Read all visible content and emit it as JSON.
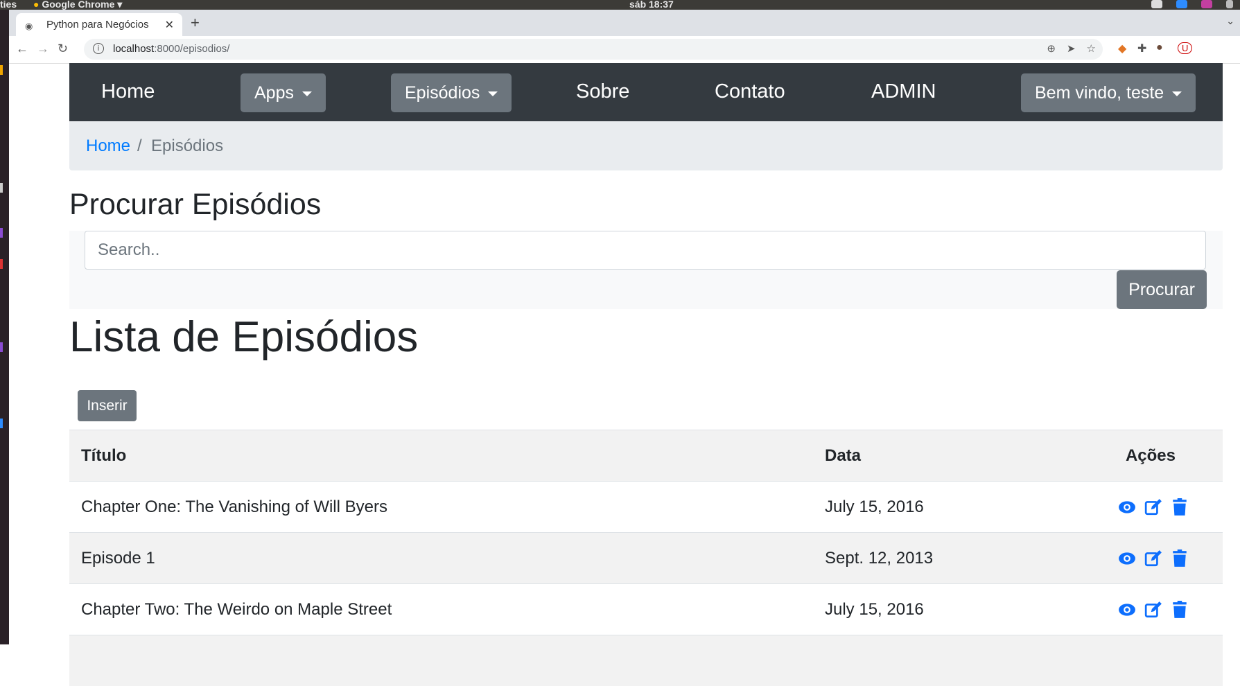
{
  "os": {
    "left_label": "ties",
    "app_label": "Google Chrome",
    "clock": "sáb 18:37"
  },
  "browser": {
    "tab_title": "Python para Negócios",
    "url_host": "localhost",
    "url_path": ":8000/episodios/"
  },
  "nav": {
    "home": "Home",
    "apps": "Apps",
    "episodios": "Episódios",
    "sobre": "Sobre",
    "contato": "Contato",
    "admin": "ADMIN",
    "user": "Bem vindo, teste"
  },
  "breadcrumb": {
    "home": "Home",
    "sep": "/",
    "current": "Episódios"
  },
  "search": {
    "title": "Procurar Episódios",
    "placeholder": "Search..",
    "button": "Procurar"
  },
  "list": {
    "title": "Lista de Episódios",
    "insert_button": "Inserir",
    "headers": {
      "titulo": "Título",
      "data": "Data",
      "acoes": "Ações"
    },
    "rows": [
      {
        "titulo": "Chapter One: The Vanishing of Will Byers",
        "data": "July 15, 2016"
      },
      {
        "titulo": "Episode 1",
        "data": "Sept. 12, 2013"
      },
      {
        "titulo": "Chapter Two: The Weirdo on Maple Street",
        "data": "July 15, 2016"
      }
    ]
  },
  "colors": {
    "navbar": "#343a40",
    "secondary": "#6c757d",
    "link": "#007bff",
    "action_icon": "#0d6efd"
  },
  "icons": {
    "view": "eye-icon",
    "edit": "edit-icon",
    "delete": "trash-icon"
  }
}
